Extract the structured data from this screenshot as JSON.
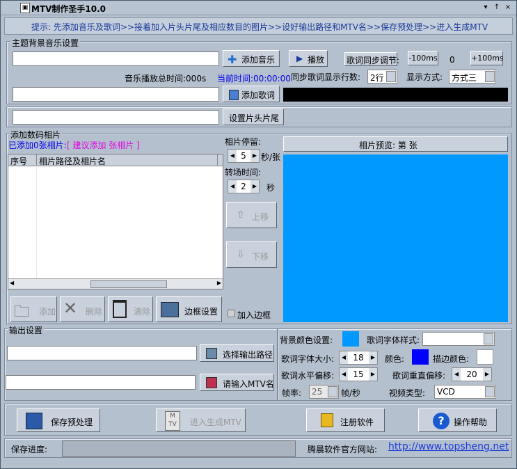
{
  "window": {
    "title": "MTV制作圣手10.0",
    "controls": [
      "▾",
      "↑",
      "×"
    ]
  },
  "hint": "提示: 先添加音乐及歌词>>接着加入片头片尾及相应数目的图片>>设好输出路径和MTV名>>保存预处理>>进入生成MTV",
  "music": {
    "group_label": "主题背景音乐设置",
    "add_music_label": "添加音乐",
    "play_label": "播放",
    "sync_label": "歌词同步调节:",
    "minus_label": "-100ms",
    "sync_value": "0",
    "plus_label": "+100ms",
    "total_time_label": "音乐播放总时间:000s",
    "current_time_label": "当前时间:00:00:00",
    "sync_rows_label": "同步歌词显示行数:",
    "sync_rows_value": "2行",
    "display_mode_label": "显示方式:",
    "display_mode_value": "方式三",
    "add_lyrics_label": "添加歌词",
    "set_head_tail_label": "设置片头片尾"
  },
  "photos": {
    "group_label": "添加数码相片",
    "added_count_label": "已添加0张相片:",
    "suggest_label": "[ 建议添加  张相片 ]",
    "columns": [
      "序号",
      "相片路径及相片名"
    ],
    "stay_label": "相片停留:",
    "stay_value": "5",
    "stay_unit": "秒/张",
    "transition_label": "转场时间:",
    "transition_value": "2",
    "transition_unit": "秒",
    "move_up_label": "上移",
    "move_down_label": "下移",
    "add_label": "添加",
    "delete_label": "删除",
    "clear_label": "清除",
    "border_settings_label": "边框设置",
    "add_border_label": "加入边框",
    "preview_label": "相片预览: 第  张",
    "preview_color": "#0099ff"
  },
  "output": {
    "group_label": "输出设置",
    "select_path_label": "选择输出路径",
    "mtv_name_label": "请输入MTV名",
    "bg_color_label": "背景颜色设置:",
    "bg_color": "#0099ff",
    "font_style_label": "歌词字体样式:",
    "font_size_label": "歌词字体大小:",
    "font_size_value": "18",
    "color_label": "颜色:",
    "font_color": "#0000ff",
    "stroke_color_label": "描边颜色:",
    "stroke_color": "#ffffff",
    "h_offset_label": "歌词水平偏移:",
    "h_offset_value": "15",
    "v_offset_label": "歌词重直偏移:",
    "v_offset_value": "20",
    "fps_label": "帧率:",
    "fps_value": "25",
    "fps_unit": "帧/秒",
    "video_type_label": "视频类型:",
    "video_type_value": "VCD"
  },
  "actions": {
    "save_preprocess_label": "保存预处理",
    "generate_label": "进入生成MTV",
    "register_label": "注册软件",
    "help_label": "操作帮助"
  },
  "status": {
    "progress_label": "保存进度:",
    "site_label": "腾晨软件官方网站:",
    "site_url": "http://www.topsheng.net"
  }
}
